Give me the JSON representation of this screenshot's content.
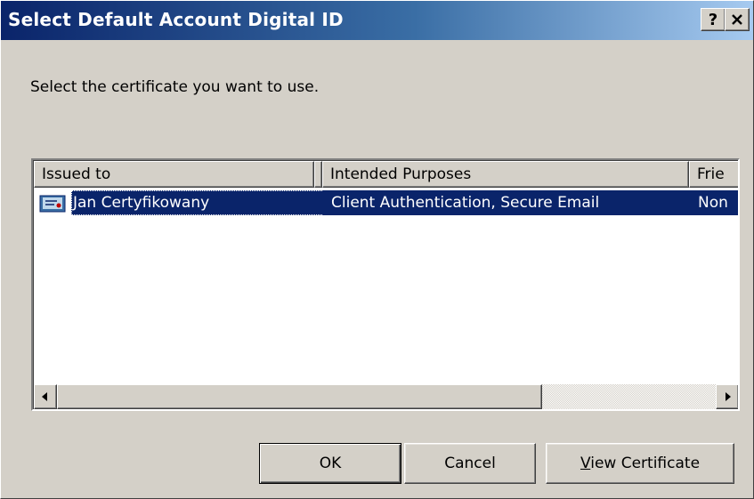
{
  "window": {
    "title": "Select Default Account Digital ID",
    "help_button": "?",
    "close_button": "✕"
  },
  "prompt": "Select the certificate you want to use.",
  "list": {
    "columns": [
      "Issued to",
      "Intended Purposes",
      "Frie"
    ],
    "rows": [
      {
        "issued_to": "Jan Certyfikowany",
        "intended_purposes": "Client Authentication, Secure Email",
        "friendly_name": "Non",
        "selected": true,
        "icon": "certificate-icon"
      }
    ]
  },
  "buttons": {
    "ok": "OK",
    "cancel": "Cancel",
    "view_certificate_mnemonic": "V",
    "view_certificate_rest": "iew Certificate"
  },
  "colors": {
    "titlebar_start": "#0a246a",
    "titlebar_end": "#a6caf0",
    "selection": "#0a246a",
    "face": "#d4d0c8"
  }
}
